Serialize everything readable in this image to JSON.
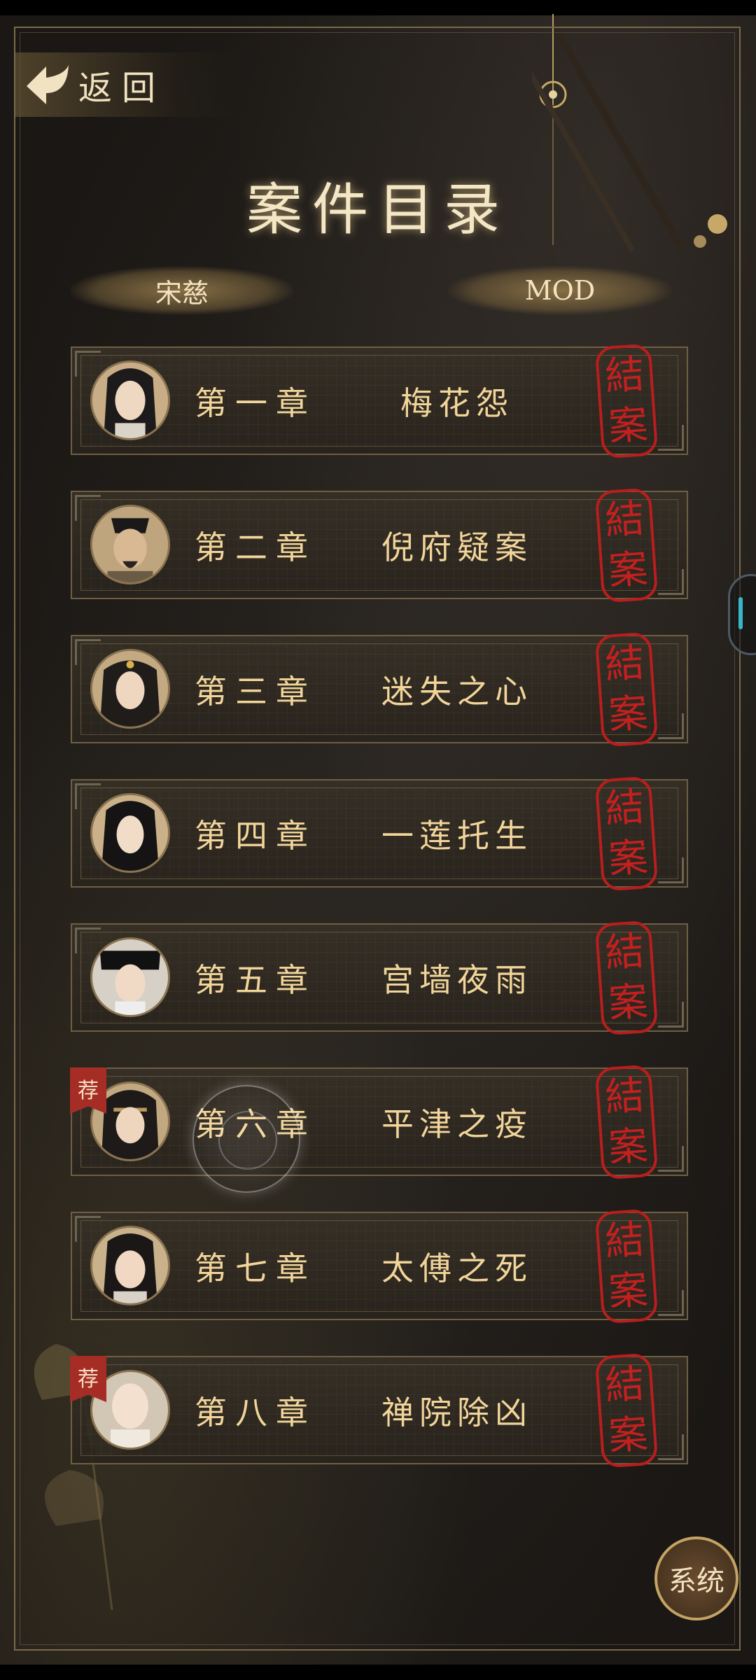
{
  "header": {
    "back_label": "返回",
    "title": "案件目录"
  },
  "tabs": [
    {
      "label": "宋慈"
    },
    {
      "label": "MOD"
    }
  ],
  "chapters": [
    {
      "number": "第一章",
      "name": "梅花怨",
      "stamp": [
        "結",
        "案"
      ]
    },
    {
      "number": "第二章",
      "name": "倪府疑案",
      "stamp": [
        "結",
        "案"
      ]
    },
    {
      "number": "第三章",
      "name": "迷失之心",
      "stamp": [
        "結",
        "案"
      ]
    },
    {
      "number": "第四章",
      "name": "一莲托生",
      "stamp": [
        "結",
        "案"
      ]
    },
    {
      "number": "第五章",
      "name": "宫墙夜雨",
      "stamp": [
        "結",
        "案"
      ]
    },
    {
      "number": "第六章",
      "name": "平津之疫",
      "stamp": [
        "結",
        "案"
      ],
      "badge": "荐"
    },
    {
      "number": "第七章",
      "name": "太傅之死",
      "stamp": [
        "結",
        "案"
      ]
    },
    {
      "number": "第八章",
      "name": "禅院除凶",
      "stamp": [
        "結",
        "案"
      ],
      "badge": "荐"
    }
  ],
  "system_button": "系统",
  "icons": {
    "back": "back-arrow-icon",
    "floating": "floating-assist-icon",
    "handle": "side-handle-icon"
  },
  "colors": {
    "accent_gold": "#f2d59a",
    "stamp_red": "#c32020",
    "frame": "#7b6a4b"
  }
}
